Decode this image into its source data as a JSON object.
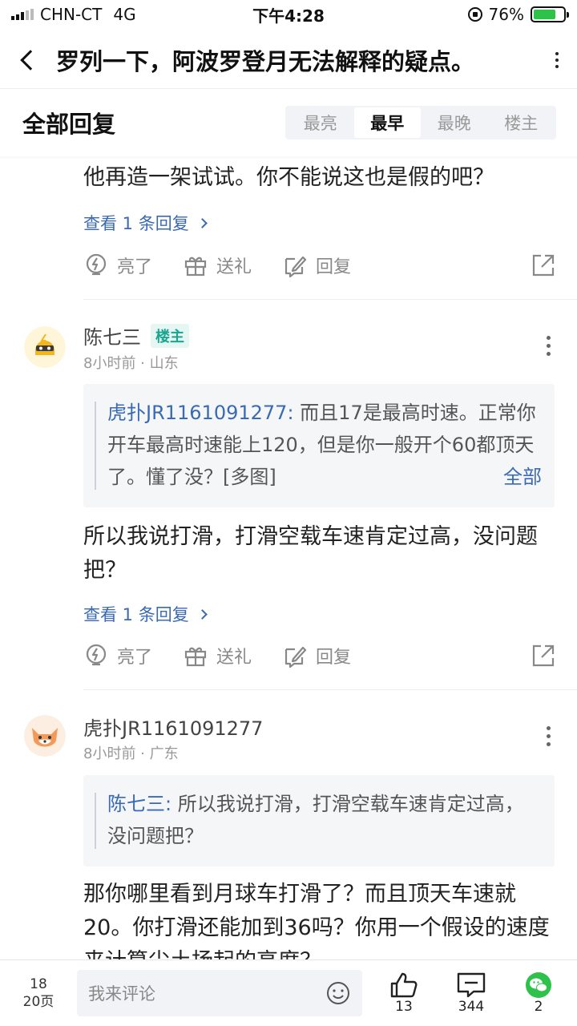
{
  "status": {
    "carrier": "CHN-CT",
    "network": "4G",
    "time": "下午4:28",
    "battery": "76%",
    "battery_level": 0.76
  },
  "header": {
    "title": "罗列一下，阿波罗登月无法解释的疑点。"
  },
  "section": {
    "title": "全部回复",
    "sort_tabs": [
      "最亮",
      "最早",
      "最晚",
      "楼主"
    ],
    "active_tab": "最早"
  },
  "post0": {
    "text": "他再造一架试试。你不能说这也是假的吧？",
    "view_replies": "查看 1 条回复"
  },
  "actions": {
    "like": "亮了",
    "gift": "送礼",
    "reply": "回复"
  },
  "post1": {
    "username": "陈七三",
    "badge": "楼主",
    "meta": "8小时前 · 山东",
    "quote_author": "虎扑JR1161091277:",
    "quote_text": " 而且17是最高时速。正常你开车最高时速能上120，但是你一般开个60都顶天了。懂了没？[多图]",
    "quote_full": "全部",
    "text": "所以我说打滑，打滑空载车速肯定过高，没问题把？",
    "view_replies": "查看 1 条回复"
  },
  "post2": {
    "username": "虎扑JR1161091277",
    "meta": "8小时前 · 广东",
    "quote_author": "陈七三:",
    "quote_text": " 所以我说打滑，打滑空载车速肯定过高，没问题把？",
    "text": "那你哪里看到月球车打滑了？而且顶天车速就20。你打滑还能加到36吗？你用一个假设的速度来计算尘土扬起的高度？"
  },
  "bottom": {
    "page_current": "18",
    "page_total": "20页",
    "comment_placeholder": "我来评论",
    "likes": "13",
    "comments": "344",
    "wechat": "2"
  },
  "colors": {
    "accent_link": "#3a6ab2",
    "op_badge": "#19a58f",
    "wechat": "#2ec24a"
  }
}
